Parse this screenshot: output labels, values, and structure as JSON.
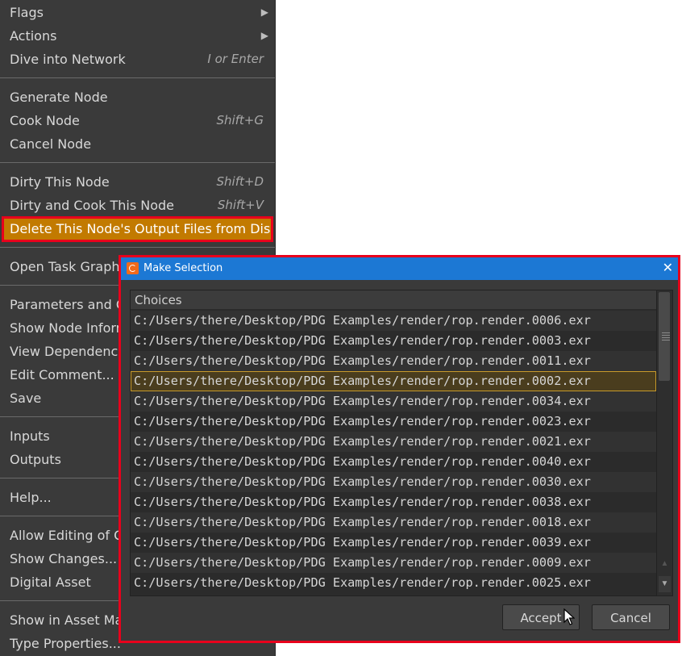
{
  "menu": {
    "items": [
      {
        "label": "Flags",
        "shortcut": "",
        "submenu": true
      },
      {
        "label": "Actions",
        "shortcut": "",
        "submenu": true
      },
      {
        "label": "Dive into Network",
        "shortcut": "I or Enter",
        "submenu": false
      },
      {
        "label": "Generate Node",
        "shortcut": ""
      },
      {
        "label": "Cook Node",
        "shortcut": "Shift+G"
      },
      {
        "label": "Cancel Node",
        "shortcut": ""
      },
      {
        "label": "Dirty This Node",
        "shortcut": "Shift+D"
      },
      {
        "label": "Dirty and Cook This Node",
        "shortcut": "Shift+V"
      },
      {
        "label": "Delete This Node's Output Files from Disk",
        "shortcut": ""
      },
      {
        "label": "Open Task Graph Table",
        "shortcut": ""
      },
      {
        "label": "Parameters and Channels",
        "shortcut": ""
      },
      {
        "label": "Show Node Information",
        "shortcut": ""
      },
      {
        "label": "View Dependencies",
        "shortcut": ""
      },
      {
        "label": "Edit Comment...",
        "shortcut": ""
      },
      {
        "label": "Save",
        "shortcut": ""
      },
      {
        "label": "Inputs",
        "shortcut": ""
      },
      {
        "label": "Outputs",
        "shortcut": ""
      },
      {
        "label": "Help...",
        "shortcut": ""
      },
      {
        "label": "Allow Editing of Contents",
        "shortcut": ""
      },
      {
        "label": "Show Changes...",
        "shortcut": ""
      },
      {
        "label": "Digital Asset",
        "shortcut": ""
      },
      {
        "label": "Show in Asset Manager...",
        "shortcut": ""
      },
      {
        "label": "Type Properties...",
        "shortcut": ""
      }
    ]
  },
  "dialog": {
    "title": "Make Selection",
    "close_glyph": "✕",
    "list_header": "Choices",
    "choices": [
      "C:/Users/there/Desktop/PDG Examples/render/rop.render.0006.exr",
      "C:/Users/there/Desktop/PDG Examples/render/rop.render.0003.exr",
      "C:/Users/there/Desktop/PDG Examples/render/rop.render.0011.exr",
      "C:/Users/there/Desktop/PDG Examples/render/rop.render.0002.exr",
      "C:/Users/there/Desktop/PDG Examples/render/rop.render.0034.exr",
      "C:/Users/there/Desktop/PDG Examples/render/rop.render.0023.exr",
      "C:/Users/there/Desktop/PDG Examples/render/rop.render.0021.exr",
      "C:/Users/there/Desktop/PDG Examples/render/rop.render.0040.exr",
      "C:/Users/there/Desktop/PDG Examples/render/rop.render.0030.exr",
      "C:/Users/there/Desktop/PDG Examples/render/rop.render.0038.exr",
      "C:/Users/there/Desktop/PDG Examples/render/rop.render.0018.exr",
      "C:/Users/there/Desktop/PDG Examples/render/rop.render.0039.exr",
      "C:/Users/there/Desktop/PDG Examples/render/rop.render.0009.exr",
      "C:/Users/there/Desktop/PDG Examples/render/rop.render.0025.exr"
    ],
    "selected_index": 3,
    "accept_label": "Accept",
    "cancel_label": "Cancel"
  },
  "colors": {
    "menu_bg": "#3a3a3a",
    "highlight": "#c27a00",
    "annotation_border": "#e8001c",
    "titlebar": "#1c78d4",
    "selection_border": "#c89a2a"
  },
  "icons": {
    "app": "houdini-logo-icon",
    "submenu": "submenu-arrow-icon",
    "close": "close-icon",
    "cursor": "mouse-pointer-icon"
  }
}
